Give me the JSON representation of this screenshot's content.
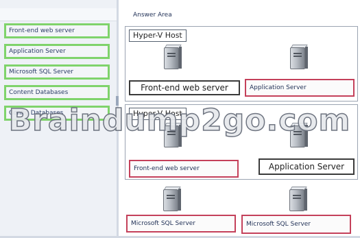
{
  "left_pane": {
    "items": [
      {
        "label": "Front-end web server"
      },
      {
        "label": "Application Server"
      },
      {
        "label": "Microsoft SQL Server"
      },
      {
        "label": "Content Databases"
      },
      {
        "label": "Config Databases"
      }
    ]
  },
  "answer_area": {
    "label": "Answer Area",
    "hosts": [
      {
        "title": "Hyper-V Host",
        "slots": [
          {
            "label": "Front-end web server",
            "style": "plain"
          },
          {
            "label": "Application Server",
            "style": "placed"
          }
        ]
      },
      {
        "title": "Hyper-V Host",
        "slots": [
          {
            "label": "Front-end web server",
            "style": "placed"
          },
          {
            "label": "Application Server",
            "style": "plain"
          }
        ]
      }
    ],
    "standalone_slots": [
      {
        "label": "Microsoft SQL Server",
        "style": "placed"
      },
      {
        "label": "Microsoft SQL Server",
        "style": "placed"
      }
    ]
  },
  "watermark": {
    "text": "Braindump2go.com"
  },
  "colors": {
    "source_border": "#7fd36b",
    "placed_border": "#c4405a",
    "text": "#1f2f55"
  },
  "icons": {
    "server": "server-tower-icon"
  }
}
